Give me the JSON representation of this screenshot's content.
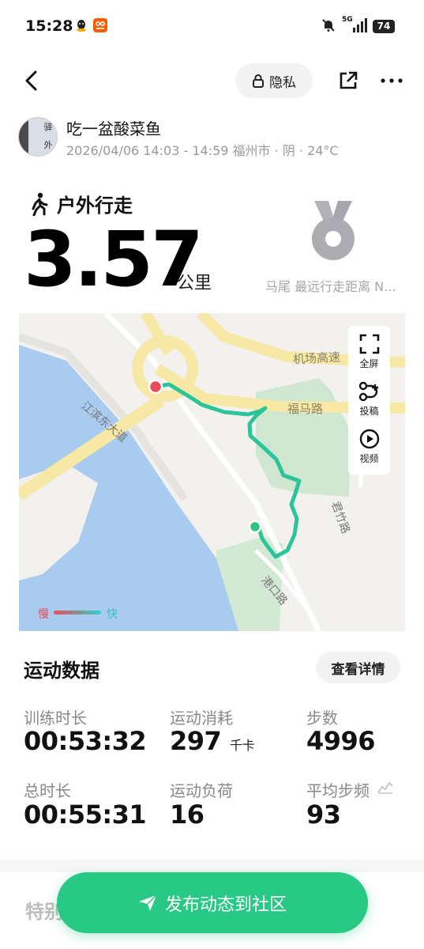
{
  "status_bar": {
    "time": "15:28",
    "network": "5G",
    "battery": "74"
  },
  "header": {
    "privacy_label": "隐私"
  },
  "user": {
    "name": "吃一盆酸菜鱼",
    "meta": "2026/04/06 14:03 - 14:59 福州市 · 阴 · 24°C",
    "avatar_text": "驿 外"
  },
  "activity": {
    "type": "户外行走",
    "distance": "3.57",
    "unit": "公里",
    "medal_label": "马尾 最远行走距离 N..."
  },
  "map": {
    "labels": {
      "airport_expressway": "机场高速",
      "fuma_road": "福马路",
      "jiangbin_avenue": "江滨东大道",
      "junzhu_road": "君竹路",
      "gangkou_road": "港口路"
    },
    "legend": {
      "slow": "慢",
      "fast": "快"
    },
    "tools": [
      {
        "label": "全屏",
        "icon": "fullscreen-icon"
      },
      {
        "label": "投稿",
        "icon": "route-post-icon"
      },
      {
        "label": "视频",
        "icon": "play-video-icon"
      }
    ]
  },
  "stats": {
    "title": "运动数据",
    "detail_button": "查看详情",
    "items": [
      {
        "label": "训练时长",
        "value": "00:53:32",
        "unit": ""
      },
      {
        "label": "运动消耗",
        "value": "297",
        "unit": "千卡"
      },
      {
        "label": "步数",
        "value": "4996",
        "unit": ""
      },
      {
        "label": "总时长",
        "value": "00:55:31",
        "unit": ""
      },
      {
        "label": "运动负荷",
        "value": "16",
        "unit": ""
      },
      {
        "label": "平均步频",
        "value": "93",
        "unit": ""
      }
    ]
  },
  "special_section": {
    "title": "特别"
  },
  "publish_button": {
    "label": "发布动态到社区"
  },
  "colors": {
    "accent": "#27c985",
    "route": "#2cc59a",
    "start": "#e84c5a",
    "end": "#2fc47f",
    "water": "#a4c8f0",
    "park": "#cfe6d1",
    "road": "#f8e9a8"
  }
}
